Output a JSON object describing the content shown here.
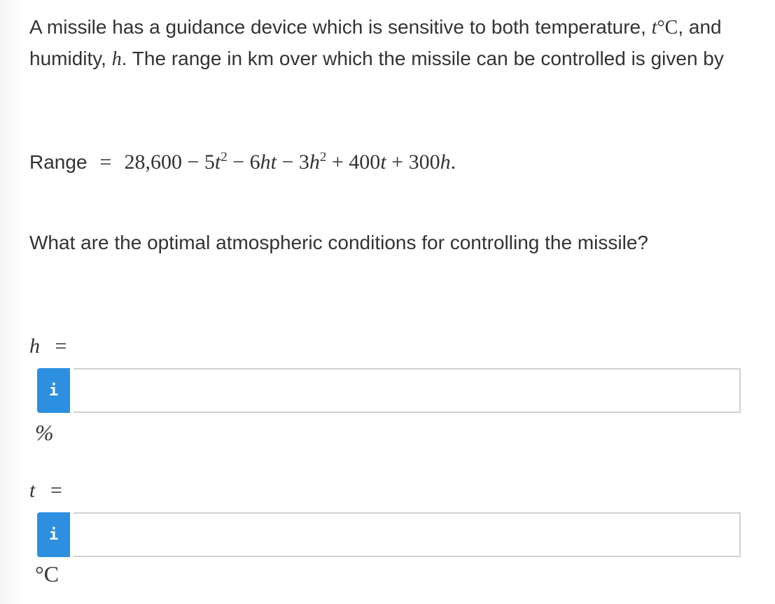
{
  "problem": {
    "intro_prefix": "A missile has a guidance device which is sensitive to both temperature, ",
    "intro_temp_var": "t",
    "intro_temp_unit": "°C",
    "intro_mid": ", and humidity, ",
    "intro_humidity_var": "h",
    "intro_suffix": ". The range in km over which the missile can be controlled is given by",
    "equation_label": "Range",
    "equation_equals": "=",
    "equation_rhs_parts": {
      "c0": "28,600 − 5",
      "v1": "t",
      "e1": "2",
      "c1": " − 6",
      "v2": "ht",
      "c2": " − 3",
      "v3": "h",
      "e3": "2",
      "c3": " + 400",
      "v4": "t",
      "c4": " + 300",
      "v5": "h",
      "c5": "."
    },
    "question": "What are the optimal atmospheric conditions for controlling the missile?"
  },
  "answers": [
    {
      "variable": "h",
      "equals": "=",
      "info_label": "i",
      "value": "",
      "unit": "%"
    },
    {
      "variable": "t",
      "equals": "=",
      "info_label": "i",
      "value": "",
      "unit": "°C"
    }
  ],
  "colors": {
    "info_button": "#2d8fe0",
    "text": "#333333",
    "input_border": "#d0d0d0"
  }
}
